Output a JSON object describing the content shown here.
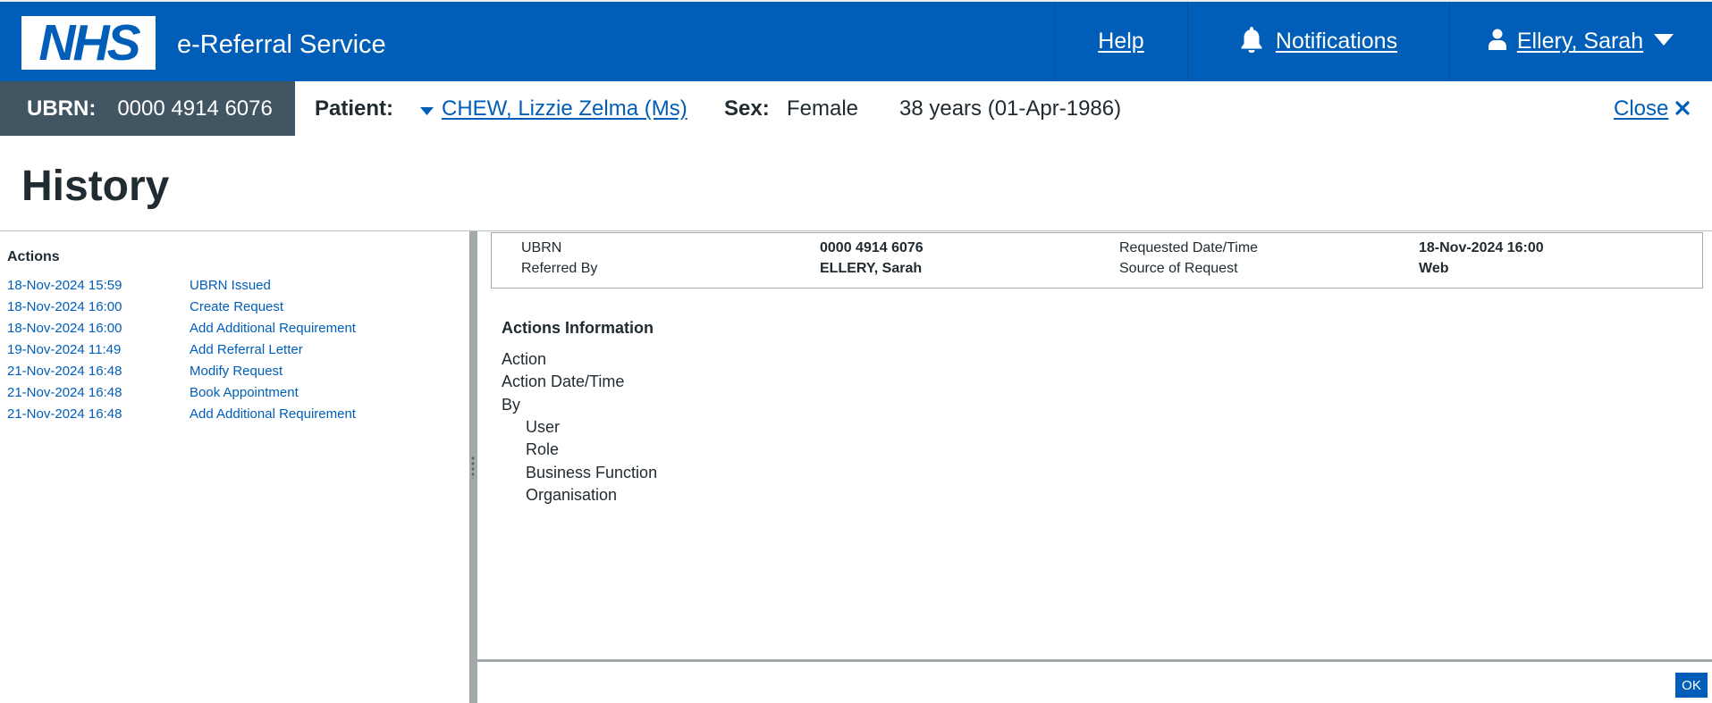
{
  "header": {
    "logo_text": "NHS",
    "service_name": "e-Referral Service",
    "help_label": "Help",
    "notifications_label": "Notifications",
    "user_label": "Ellery, Sarah"
  },
  "banner": {
    "ubrn_label": "UBRN:",
    "ubrn_value": "0000 4914 6076",
    "patient_label": "Patient:",
    "patient_name": "CHEW, Lizzie Zelma (Ms)",
    "sex_label": "Sex:",
    "sex_value": "Female",
    "age_dob": "38 years (01-Apr-1986)",
    "close_label": "Close"
  },
  "page_title": "History",
  "actions": {
    "heading": "Actions",
    "items": [
      {
        "datetime": "18-Nov-2024 15:59",
        "action": "UBRN Issued"
      },
      {
        "datetime": "18-Nov-2024 16:00",
        "action": "Create Request"
      },
      {
        "datetime": "18-Nov-2024 16:00",
        "action": "Add Additional Requirement"
      },
      {
        "datetime": "19-Nov-2024 11:49",
        "action": "Add Referral Letter"
      },
      {
        "datetime": "21-Nov-2024 16:48",
        "action": "Modify Request"
      },
      {
        "datetime": "21-Nov-2024 16:48",
        "action": "Book Appointment"
      },
      {
        "datetime": "21-Nov-2024 16:48",
        "action": "Add Additional Requirement"
      }
    ]
  },
  "summary": {
    "ubrn_label": "UBRN",
    "ubrn_value": "0000 4914 6076",
    "referred_by_label": "Referred By",
    "referred_by_value": "ELLERY, Sarah",
    "requested_label": "Requested Date/Time",
    "requested_value": "18-Nov-2024 16:00",
    "source_label": "Source of Request",
    "source_value": "Web"
  },
  "actions_information": {
    "heading": "Actions Information",
    "action_label": "Action",
    "datetime_label": "Action Date/Time",
    "by_label": "By",
    "user_label": "User",
    "role_label": "Role",
    "business_function_label": "Business Function",
    "organisation_label": "Organisation"
  },
  "footer": {
    "ok_label": "OK"
  },
  "colors": {
    "nhs_blue": "#005eb8",
    "banner_grey": "#425563",
    "text": "#212b32"
  }
}
